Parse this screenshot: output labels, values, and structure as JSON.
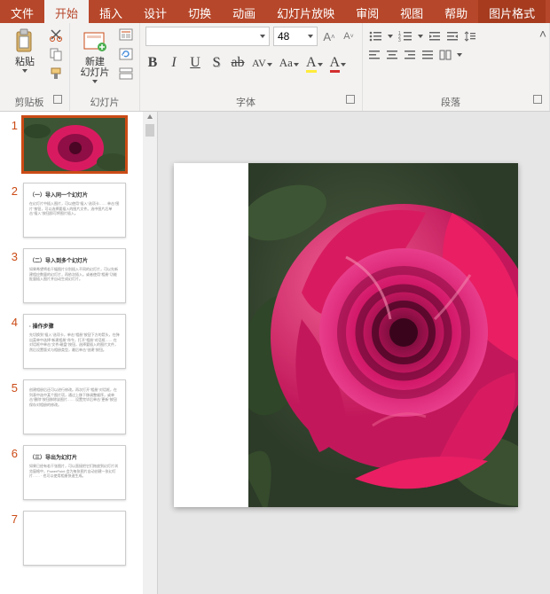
{
  "tabs": {
    "file": "文件",
    "home": "开始",
    "insert": "插入",
    "design": "设计",
    "transitions": "切换",
    "animations": "动画",
    "slideshow": "幻灯片放映",
    "review": "审阅",
    "view": "视图",
    "help": "帮助",
    "picture_format": "图片格式"
  },
  "ribbon": {
    "clipboard": {
      "paste": "粘贴",
      "label": "剪贴板"
    },
    "slides": {
      "new_slide": "新建\n幻灯片",
      "label": "幻灯片"
    },
    "font": {
      "size": "48",
      "label": "字体"
    },
    "paragraph": {
      "label": "段落"
    }
  },
  "thumbnails": [
    {
      "num": "1",
      "type": "image",
      "selected": true
    },
    {
      "num": "2",
      "type": "text",
      "title": "（一）导入同一个幻灯片",
      "body": "在幻灯片中插入图片，可以使用\"插入\"选项卡…… 单击\"图片\"按钮，可以选择要插入的图片文件。选中图片后单击\"插入\"按钮即可将图片插入。"
    },
    {
      "num": "3",
      "type": "text",
      "title": "（二）导入到多个幻灯片",
      "body": "如果希望将若干幅图片分别插入不同的幻灯片，可以先新建相应数量的幻灯片，再依次插入。或者使用\"相册\"功能批量插入图片并自动生成幻灯片。"
    },
    {
      "num": "4",
      "type": "text",
      "title": "  · 操作步骤",
      "body": "先切换到\"插入\"选项卡，单击\"相册\"按钮下方的箭头，在弹出菜单中选择\"新建相册\"命令，打开\"相册\"对话框……\n\n在对话框中单击\"文件/磁盘\"按钮，选择要插入的图片文件，然后设置版式与相册类型，最后单击\"创建\"按钮。"
    },
    {
      "num": "5",
      "type": "text",
      "title": "",
      "body": "创建相册后还可以进行修改。再次打开\"相册\"对话框，在列表中选中某个图片项，通过上移下移调整顺序，或单击\"删除\"按钮移除该图片……\n\n设置完毕后单击\"更新\"按钮保存对相册的修改。"
    },
    {
      "num": "6",
      "type": "text",
      "title": "（三）导出为幻灯片",
      "body": "如果已经有若干张图片，可以直接把它们拖放到幻灯片浏览窗格中，PowerPoint 会为每张图片自动创建一张幻灯片……\n  · 也可以使用相册快速生成。"
    },
    {
      "num": "7",
      "type": "text",
      "title": "",
      "body": ""
    }
  ]
}
